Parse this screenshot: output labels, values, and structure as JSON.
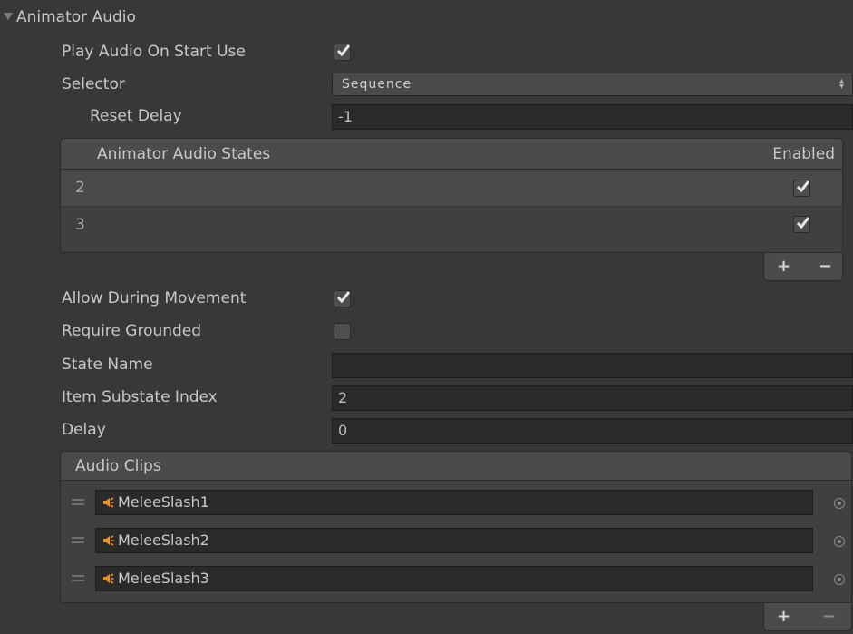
{
  "header": {
    "title": "Animator Audio"
  },
  "fields": {
    "play_audio_on_start_use": {
      "label": "Play Audio On Start Use",
      "checked": true
    },
    "selector": {
      "label": "Selector",
      "value": "Sequence"
    },
    "reset_delay": {
      "label": "Reset Delay",
      "value": "-1"
    },
    "allow_during_movement": {
      "label": "Allow During Movement",
      "checked": true
    },
    "require_grounded": {
      "label": "Require Grounded",
      "checked": false
    },
    "state_name": {
      "label": "State Name",
      "value": ""
    },
    "item_substate_index": {
      "label": "Item Substate Index",
      "value": "2"
    },
    "delay": {
      "label": "Delay",
      "value": "0"
    }
  },
  "states_list": {
    "header": "Animator Audio States",
    "column_enabled": "Enabled",
    "rows": [
      {
        "label": "2",
        "enabled": true
      },
      {
        "label": "3",
        "enabled": true
      }
    ],
    "add_label": "+",
    "remove_label": "−"
  },
  "clips_list": {
    "header": "Audio Clips",
    "items": [
      {
        "name": "MeleeSlash1"
      },
      {
        "name": "MeleeSlash2"
      },
      {
        "name": "MeleeSlash3"
      }
    ],
    "add_label": "+",
    "remove_label": "−"
  },
  "colors": {
    "background": "#383838",
    "field_bg": "#2a2a2a",
    "list_header_bg": "#4b4b4b",
    "audio_icon": "#e8962a"
  },
  "icons": [
    "foldout-triangle-icon",
    "checkmark-icon",
    "popup-arrows-icon",
    "drag-handle-icon",
    "audio-clip-icon",
    "object-picker-icon"
  ]
}
